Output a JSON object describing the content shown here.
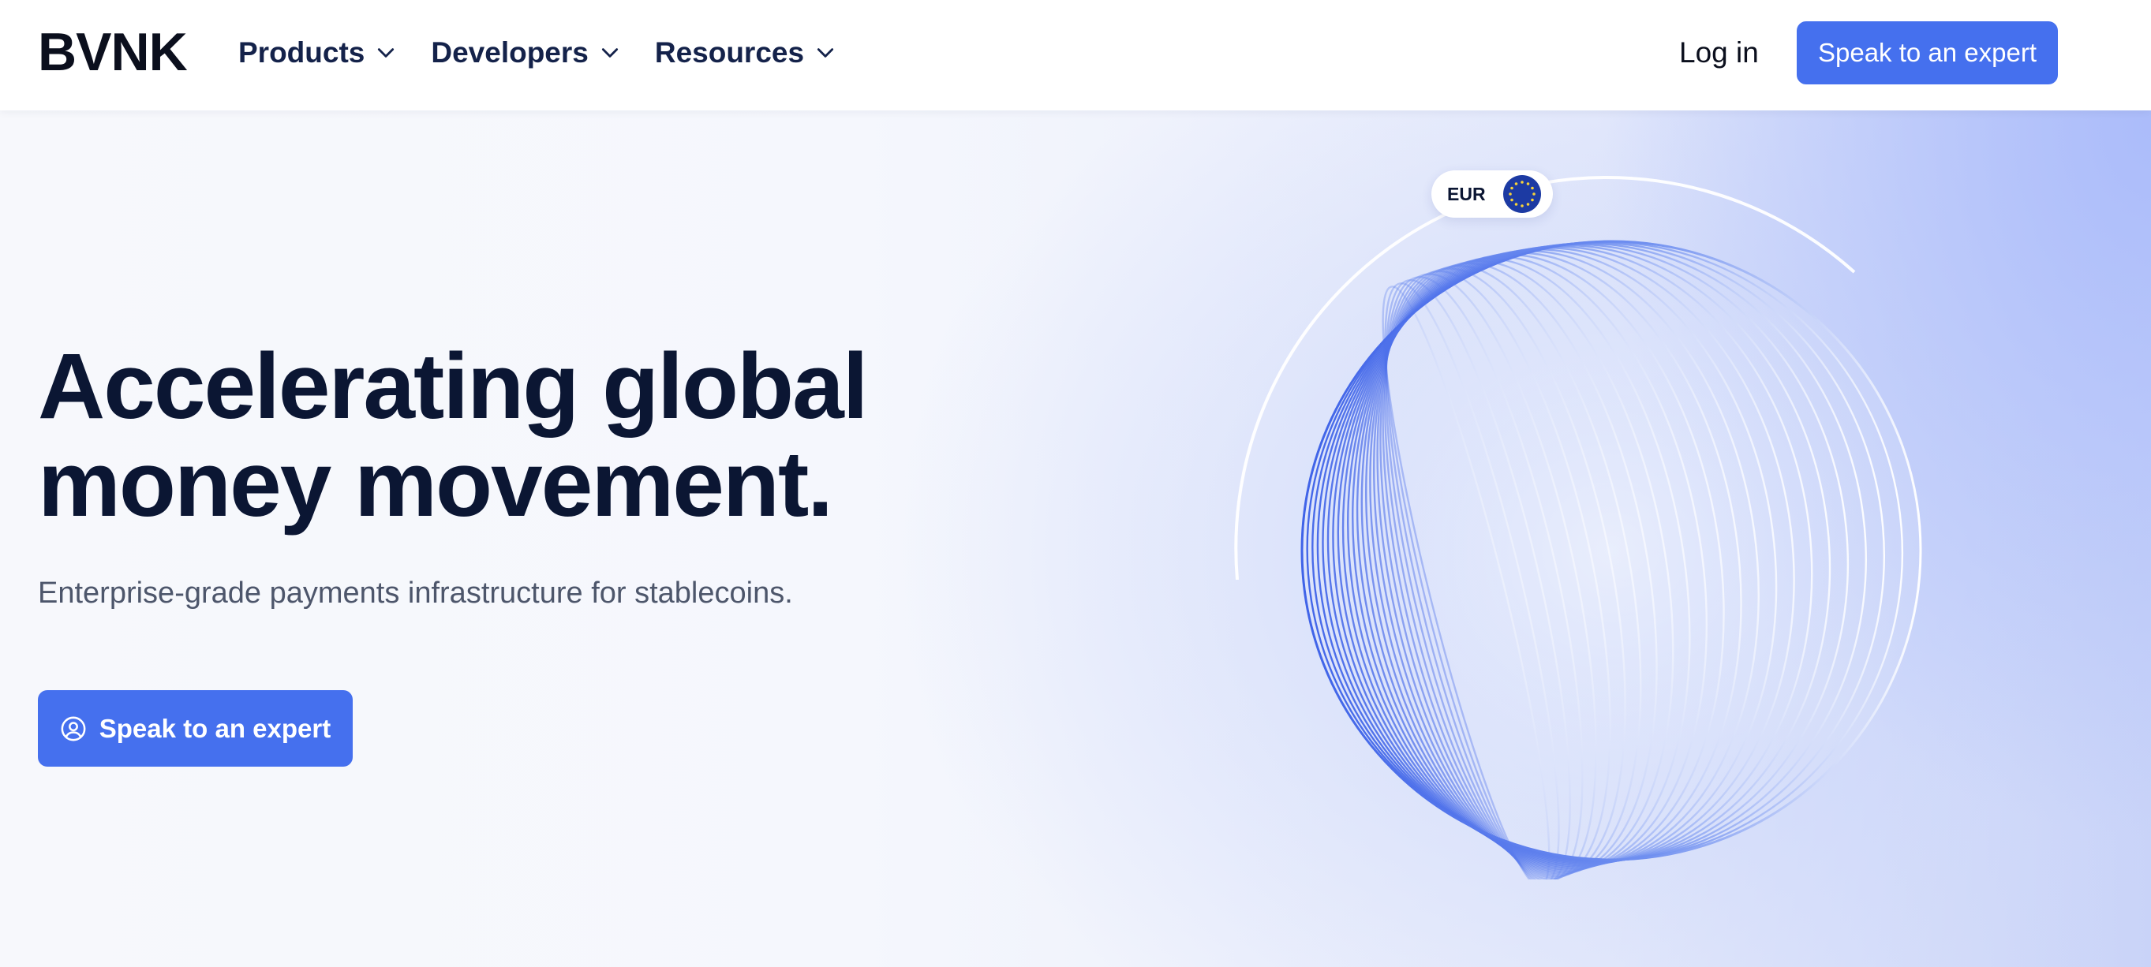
{
  "brand": {
    "logo_text": "BVNK"
  },
  "nav": {
    "items": [
      {
        "label": "Products",
        "icon": "chevron-down-icon"
      },
      {
        "label": "Developers",
        "icon": "chevron-down-icon"
      },
      {
        "label": "Resources",
        "icon": "chevron-down-icon"
      }
    ],
    "login_label": "Log in",
    "cta_label": "Speak to an expert"
  },
  "hero": {
    "headline_line1": "Accelerating global",
    "headline_line2": "money movement.",
    "subheadline": "Enterprise-grade payments infrastructure for stablecoins.",
    "cta_label": "Speak to an expert",
    "cta_icon": "user-circle-icon"
  },
  "visual": {
    "currency_badge": "EUR",
    "currency_icon": "eu-flag-icon",
    "globe_icon": "wireframe-globe"
  },
  "colors": {
    "accent": "#4570ee",
    "heading": "#0b1633",
    "nav_text": "#14224a",
    "body_text": "#4d566b"
  }
}
